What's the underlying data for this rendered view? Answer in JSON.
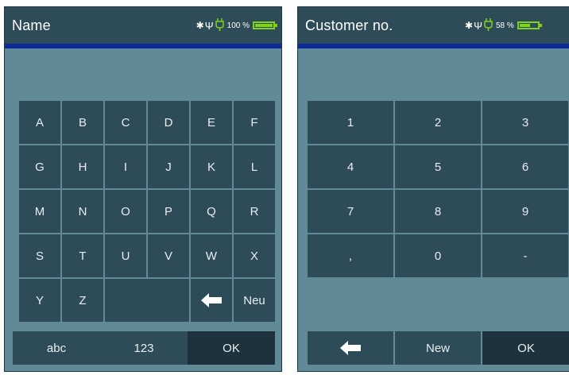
{
  "left": {
    "title": "Name",
    "status": {
      "battery_percent": "100 %",
      "battery_level": 1.0
    },
    "letters": [
      "A",
      "B",
      "C",
      "D",
      "E",
      "F",
      "G",
      "H",
      "I",
      "J",
      "K",
      "L",
      "M",
      "N",
      "O",
      "P",
      "Q",
      "R",
      "S",
      "T",
      "U",
      "V",
      "W",
      "X",
      "Y",
      "Z"
    ],
    "neu_label": "Neu",
    "bottom": {
      "abc_label": "abc",
      "num_label": "123",
      "ok_label": "OK"
    }
  },
  "right": {
    "title": "Customer no.",
    "status": {
      "battery_percent": "58 %",
      "battery_level": 0.58
    },
    "digits": [
      "1",
      "2",
      "3",
      "4",
      "5",
      "6",
      "7",
      "8",
      "9",
      ",",
      "0",
      "-"
    ],
    "bottom": {
      "new_label": "New",
      "ok_label": "OK"
    }
  },
  "colors": {
    "screen_bg": "#608a96",
    "header_bg": "#2e4b58",
    "accent": "#0a2a9a",
    "key_bg": "#2e4b58",
    "key_dark_bg": "#1d323c",
    "battery": "#7fd11d"
  },
  "icons": [
    "bluetooth-icon",
    "usb-icon",
    "plug-icon",
    "battery-icon",
    "backspace-arrow-icon"
  ]
}
